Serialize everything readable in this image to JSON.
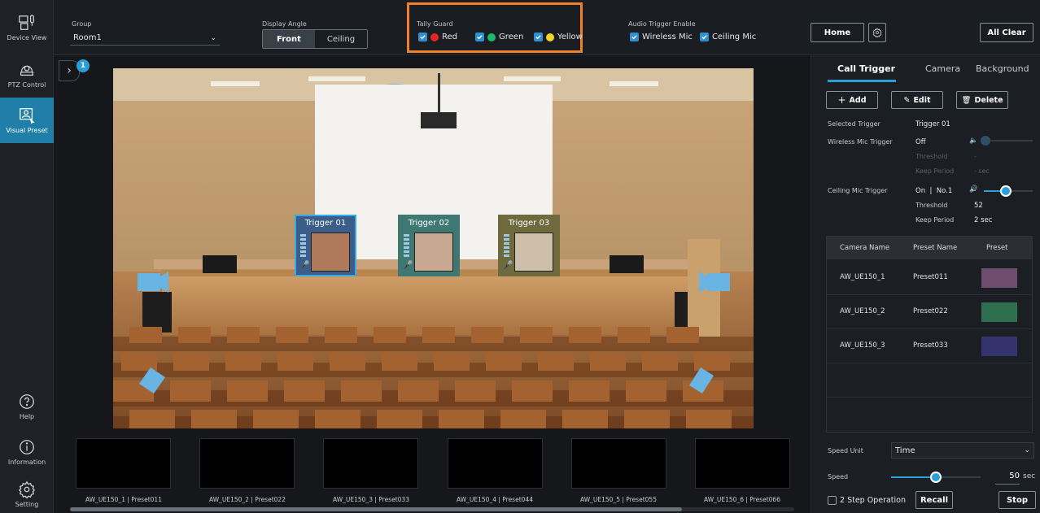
{
  "nav": {
    "items": [
      {
        "label": "Device View",
        "icon": "device-view-icon"
      },
      {
        "label": "PTZ Control",
        "icon": "ptz-camera-icon"
      },
      {
        "label": "Visual Preset",
        "icon": "visual-preset-icon",
        "active": true
      }
    ],
    "bottom": [
      {
        "label": "Help",
        "icon": "help-icon"
      },
      {
        "label": "Information",
        "icon": "info-icon"
      },
      {
        "label": "Setting",
        "icon": "gear-icon"
      }
    ]
  },
  "topbar": {
    "group_label": "Group",
    "group_value": "Room1",
    "display_angle_label": "Display Angle",
    "angle_front": "Front",
    "angle_ceiling": "Ceiling",
    "tally_label": "Tally Guard",
    "tally_red": "Red",
    "tally_green": "Green",
    "tally_yellow": "Yellow",
    "audio_label": "Audio Trigger Enable",
    "wireless_mic": "Wireless Mic",
    "ceiling_mic": "Ceiling Mic",
    "home": "Home",
    "all_clear": "All Clear"
  },
  "colors": {
    "accent": "#2a9ed8",
    "tally_red": "#e5252a",
    "tally_green": "#1db86a",
    "tally_yellow": "#f2d52a",
    "highlight": "#f07f2a"
  },
  "stage": {
    "badge": "1",
    "triggers": [
      {
        "label": "Trigger 01"
      },
      {
        "label": "Trigger 02"
      },
      {
        "label": "Trigger 03"
      }
    ],
    "thumbnails": [
      "AW_UE150_1 | Preset011",
      "AW_UE150_2 | Preset022",
      "AW_UE150_3 | Preset033",
      "AW_UE150_4 | Preset044",
      "AW_UE150_5 | Preset055",
      "AW_UE150_6 | Preset066"
    ]
  },
  "panel": {
    "tabs": [
      "Call Trigger",
      "Camera",
      "Background"
    ],
    "add": "Add",
    "edit": "Edit",
    "delete": "Delete",
    "selected_trigger_label": "Selected Trigger",
    "selected_trigger_value": "Trigger 01",
    "wireless_label": "Wireless Mic Trigger",
    "wireless_value": "Off",
    "threshold_label": "Threshold",
    "keep_period_label": "Keep Period",
    "wireless_threshold": "-",
    "wireless_keep": "- sec",
    "ceiling_label": "Ceiling Mic Trigger",
    "ceiling_value": "On  |  No.1",
    "ceiling_threshold": "52",
    "ceiling_keep": "2 sec",
    "ceiling_level": 0.45,
    "table_headers": [
      "Camera Name",
      "Preset Name",
      "Preset"
    ],
    "rows": [
      {
        "camera": "AW_UE150_1",
        "preset": "Preset011",
        "color": "#6e4d6e"
      },
      {
        "camera": "AW_UE150_2",
        "preset": "Preset022",
        "color": "#2f6f4f"
      },
      {
        "camera": "AW_UE150_3",
        "preset": "Preset033",
        "color": "#34336e"
      }
    ],
    "speed_unit_label": "Speed Unit",
    "speed_unit_value": "Time",
    "speed_label": "Speed",
    "speed_value": "50",
    "speed_unit_suffix": "sec",
    "speed_level": 0.5,
    "two_step": "2 Step Operation",
    "recall": "Recall",
    "stop": "Stop"
  }
}
